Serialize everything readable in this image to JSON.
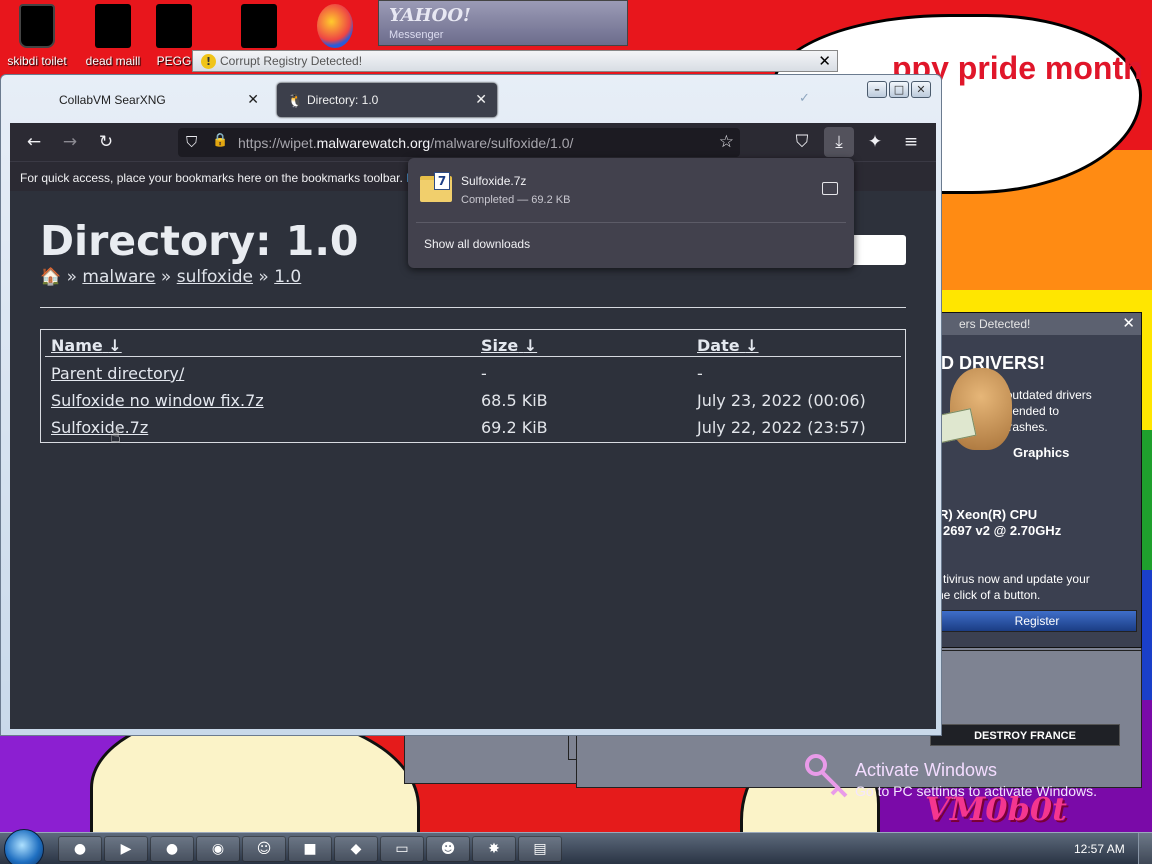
{
  "desktop": {
    "icons": [
      {
        "label": "skibdi toilet",
        "icon": "trash-bin-icon"
      },
      {
        "label": "dead maill",
        "icon": "mail-icon"
      },
      {
        "label": "PEGG",
        "icon": "firefox-icon"
      }
    ],
    "yahoo": {
      "title": "YAHOO!",
      "subtitle": "Messenger"
    },
    "bubble_text": "ppy pride month",
    "watermark": "VM0b0t"
  },
  "corrupt_window": {
    "title": "Corrupt Registry Detected!",
    "close": "✕"
  },
  "drivers_popup": {
    "title": "ers Detected!",
    "close": "✕",
    "heading": "D DRIVERS!",
    "text1": "na        d outdated drivers",
    "text2": "te      mmended to",
    "text3": "         tem crashes.",
    "graphics": "Graphics",
    "cpu1": "l(R) Xeon(R) CPU",
    "cpu2": "2697 v2 @ 2.70GHz",
    "text4": "tivirus now and update your",
    "text5": "he click of a button.",
    "register": "Register"
  },
  "destroy_button": "DESTROY FRANCE",
  "activate": {
    "line1": "Activate Windows",
    "line2": "Go to PC settings to activate Windows."
  },
  "browser": {
    "tabs": [
      {
        "label": "CollabVM SearXNG",
        "active": false
      },
      {
        "label": "Directory: 1.0",
        "active": true
      }
    ],
    "tab_close": "✕",
    "url_prefix": "https://wipet.",
    "url_domain": "malwarewatch.org",
    "url_path": "/malware/sulfoxide/1.0/",
    "bookmarks_text": "For quick access, place your bookmarks here on the bookmarks toolbar.",
    "bookmarks_link": "M",
    "page": {
      "title": "Directory: 1.0",
      "breadcrumb": [
        {
          "label": "malware"
        },
        {
          "label": "sulfoxide"
        },
        {
          "label": "1.0"
        }
      ],
      "breadcrumb_sep": "»",
      "table": {
        "headers": {
          "name": "Name",
          "size": "Size",
          "date": "Date",
          "sort": "↓"
        },
        "rows": [
          {
            "name": "Parent directory/",
            "size": "-",
            "date": "-"
          },
          {
            "name": "Sulfoxide no window fix.7z",
            "size": "68.5 KiB",
            "date": "July 23, 2022 (00:06)"
          },
          {
            "name": "Sulfoxide.7z",
            "size": "69.2 KiB",
            "date": "July 22, 2022 (23:57)"
          }
        ]
      }
    },
    "downloads": {
      "filename": "Sulfoxide.7z",
      "status": "Completed — 69.2 KB",
      "show_all": "Show all downloads"
    }
  },
  "taskbar": {
    "clock": "12:57 AM"
  },
  "colors": {
    "page_bg": "#2d313b",
    "toolbar_bg": "#2b2a33",
    "download_panel_bg": "#42414d"
  }
}
